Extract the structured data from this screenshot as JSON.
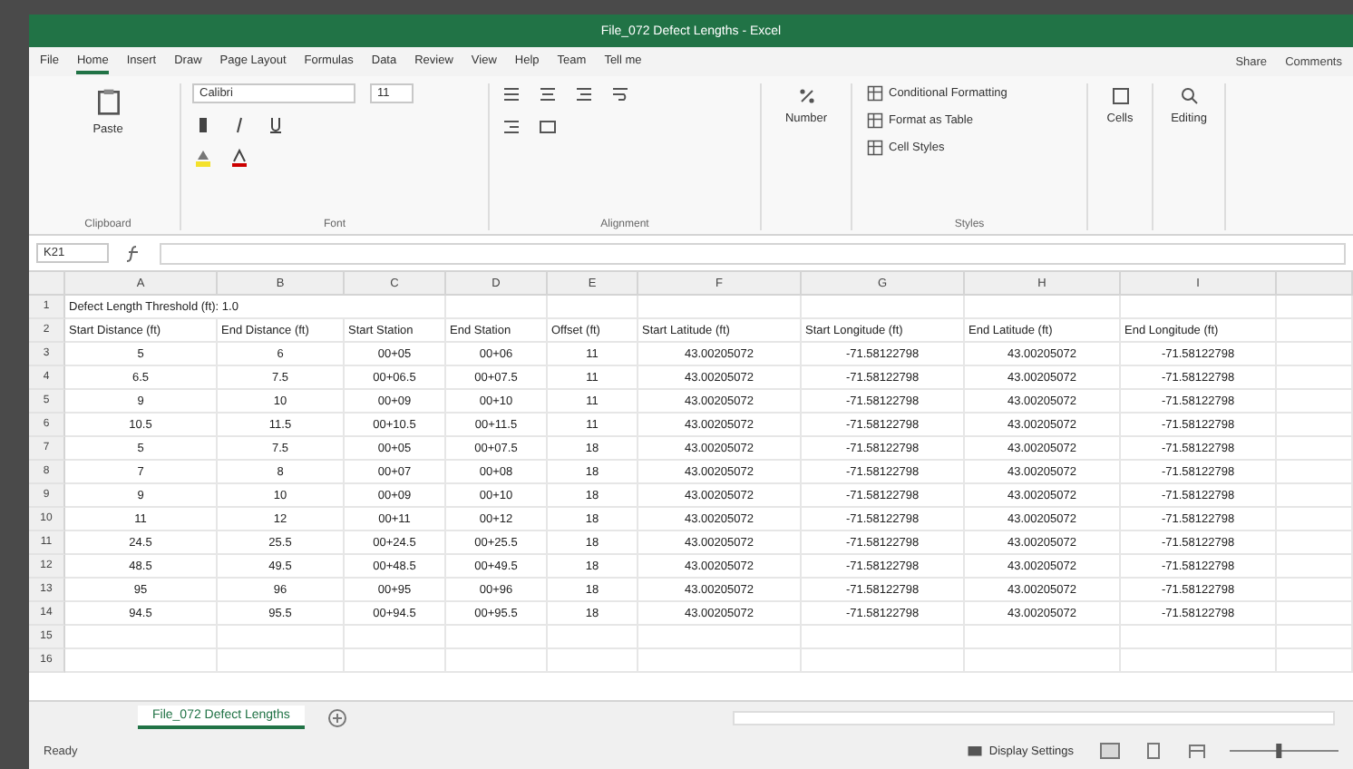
{
  "window": {
    "title": "File_072 Defect Lengths - Excel"
  },
  "ribbon_tabs": [
    {
      "label": "File",
      "selected": false
    },
    {
      "label": "Home",
      "selected": true
    },
    {
      "label": "Insert",
      "selected": false
    },
    {
      "label": "Draw",
      "selected": false
    },
    {
      "label": "Page Layout",
      "selected": false
    },
    {
      "label": "Formulas",
      "selected": false
    },
    {
      "label": "Data",
      "selected": false
    },
    {
      "label": "Review",
      "selected": false
    },
    {
      "label": "View",
      "selected": false
    },
    {
      "label": "Help",
      "selected": false
    },
    {
      "label": "Team",
      "selected": false
    },
    {
      "label": "Tell me",
      "selected": false
    }
  ],
  "share": "Share",
  "comments": "Comments",
  "ribbon": {
    "paste": "Paste",
    "font_name": "Calibri",
    "font_size": "11",
    "number": "Number",
    "styles": [
      "Conditional Formatting",
      "Format as Table",
      "Cell Styles"
    ],
    "cells": "Cells",
    "editing": "Editing",
    "groups": [
      "Clipboard",
      "Font",
      "Alignment",
      "Styles"
    ]
  },
  "name_box": "K21",
  "columns": [
    "A",
    "B",
    "C",
    "D",
    "E",
    "F",
    "G",
    "H",
    "I"
  ],
  "title_cell": "Defect Length Threshold (ft): 1.0",
  "headers": [
    "Start Distance (ft)",
    "End Distance (ft)",
    "Start Station",
    "End Station",
    "Offset (ft)",
    "Start Latitude (ft)",
    "Start Longitude (ft)",
    "End Latitude (ft)",
    "End Longitude (ft)"
  ],
  "rows": [
    [
      "5",
      "6",
      "00+05",
      "00+06",
      "11",
      "43.00205072",
      "-71.58122798",
      "43.00205072",
      "-71.58122798"
    ],
    [
      "6.5",
      "7.5",
      "00+06.5",
      "00+07.5",
      "11",
      "43.00205072",
      "-71.58122798",
      "43.00205072",
      "-71.58122798"
    ],
    [
      "9",
      "10",
      "00+09",
      "00+10",
      "11",
      "43.00205072",
      "-71.58122798",
      "43.00205072",
      "-71.58122798"
    ],
    [
      "10.5",
      "11.5",
      "00+10.5",
      "00+11.5",
      "11",
      "43.00205072",
      "-71.58122798",
      "43.00205072",
      "-71.58122798"
    ],
    [
      "5",
      "7.5",
      "00+05",
      "00+07.5",
      "18",
      "43.00205072",
      "-71.58122798",
      "43.00205072",
      "-71.58122798"
    ],
    [
      "7",
      "8",
      "00+07",
      "00+08",
      "18",
      "43.00205072",
      "-71.58122798",
      "43.00205072",
      "-71.58122798"
    ],
    [
      "9",
      "10",
      "00+09",
      "00+10",
      "18",
      "43.00205072",
      "-71.58122798",
      "43.00205072",
      "-71.58122798"
    ],
    [
      "11",
      "12",
      "00+11",
      "00+12",
      "18",
      "43.00205072",
      "-71.58122798",
      "43.00205072",
      "-71.58122798"
    ],
    [
      "24.5",
      "25.5",
      "00+24.5",
      "00+25.5",
      "18",
      "43.00205072",
      "-71.58122798",
      "43.00205072",
      "-71.58122798"
    ],
    [
      "48.5",
      "49.5",
      "00+48.5",
      "00+49.5",
      "18",
      "43.00205072",
      "-71.58122798",
      "43.00205072",
      "-71.58122798"
    ],
    [
      "95",
      "96",
      "00+95",
      "00+96",
      "18",
      "43.00205072",
      "-71.58122798",
      "43.00205072",
      "-71.58122798"
    ],
    [
      "94.5",
      "95.5",
      "00+94.5",
      "00+95.5",
      "18",
      "43.00205072",
      "-71.58122798",
      "43.00205072",
      "-71.58122798"
    ]
  ],
  "row_numbers": [
    "1",
    "2",
    "3",
    "4",
    "5",
    "6",
    "7",
    "8",
    "9",
    "10",
    "11",
    "12",
    "13",
    "14",
    "15",
    "16"
  ],
  "sheet_tabs": [
    {
      "label": "File_072 Defect Lengths",
      "selected": true
    }
  ],
  "status": "Ready",
  "zoom_slider": {
    "level": 0.45
  },
  "display_settings": "Display Settings"
}
